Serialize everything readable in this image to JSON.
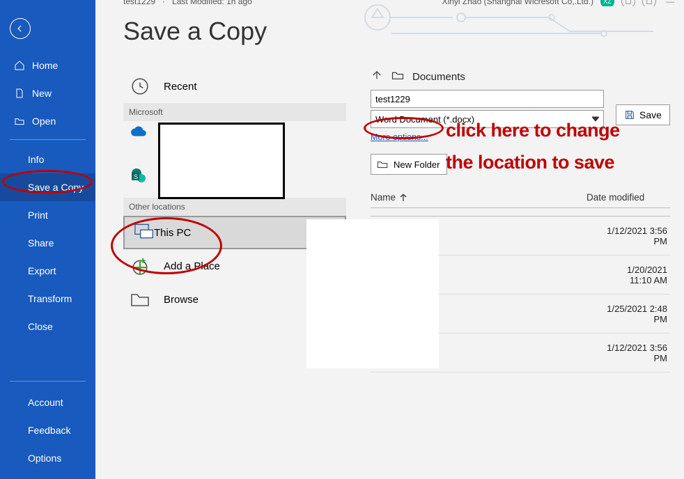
{
  "top_strip": {
    "filename": "test1229",
    "modified": "Last Modified: 1h ago",
    "user": "Xinyi Zhao (Shanghai Wicresoft Co,.Ltd.)",
    "badge": "XZ"
  },
  "page_title": "Save a Copy",
  "sidebar": {
    "home": "Home",
    "new": "New",
    "open": "Open",
    "subs": {
      "info": "Info",
      "save_copy": "Save a Copy",
      "print": "Print",
      "share": "Share",
      "export": "Export",
      "transform": "Transform",
      "close": "Close"
    },
    "bottom": {
      "account": "Account",
      "feedback": "Feedback",
      "options": "Options"
    }
  },
  "locations": {
    "recent": "Recent",
    "heading_ms": "Microsoft",
    "heading_other": "Other locations",
    "this_pc": "This PC",
    "add_place": "Add a Place",
    "browse": "Browse"
  },
  "save_panel": {
    "up_crumb": "Documents",
    "filename_value": "test1229",
    "filetype": "Word Document (*.docx)",
    "save_label": "Save",
    "more_link": "More options...",
    "new_folder": "New Folder",
    "col_name": "Name",
    "col_date": "Date modified",
    "rows": [
      {
        "date": "1/12/2021 3:56 PM"
      },
      {
        "date": "1/20/2021 11:10 AM"
      },
      {
        "date": "1/25/2021 2:48 PM"
      },
      {
        "date": "1/12/2021 3:56 PM"
      }
    ]
  },
  "annotation": {
    "line1": "click here to change",
    "line2": "the location to save"
  }
}
